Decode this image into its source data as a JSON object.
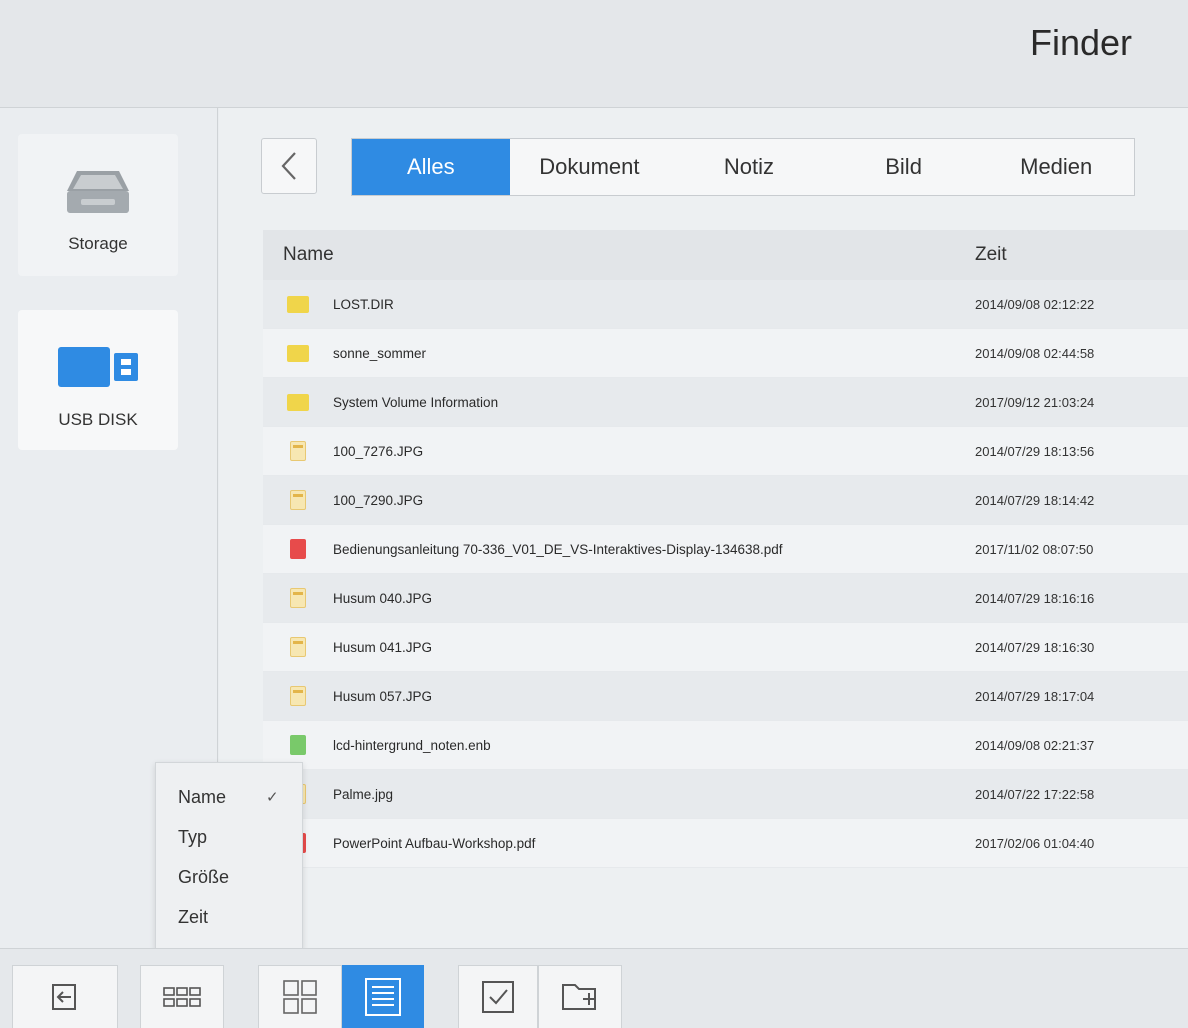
{
  "header": {
    "title": "Finder"
  },
  "sidebar": {
    "items": [
      {
        "label": "Storage",
        "icon": "drive-icon"
      },
      {
        "label": "USB DISK",
        "icon": "usb-icon"
      }
    ]
  },
  "tabs": [
    "Alles",
    "Dokument",
    "Notiz",
    "Bild",
    "Medien"
  ],
  "active_tab": "Alles",
  "table": {
    "headers": {
      "name": "Name",
      "time": "Zeit"
    },
    "rows": [
      {
        "name": "LOST.DIR",
        "time": "2014/09/08 02:12:22",
        "type": "folder"
      },
      {
        "name": "sonne_sommer",
        "time": "2014/09/08 02:44:58",
        "type": "folder"
      },
      {
        "name": "System Volume Information",
        "time": "2017/09/12 21:03:24",
        "type": "folder"
      },
      {
        "name": "100_7276.JPG",
        "time": "2014/07/29 18:13:56",
        "type": "image"
      },
      {
        "name": "100_7290.JPG",
        "time": "2014/07/29 18:14:42",
        "type": "image"
      },
      {
        "name": "Bedienungsanleitung 70-336_V01_DE_VS-Interaktives-Display-134638.pdf",
        "time": "2017/11/02 08:07:50",
        "type": "pdf"
      },
      {
        "name": "Husum 040.JPG",
        "time": "2014/07/29 18:16:16",
        "type": "image"
      },
      {
        "name": "Husum 041.JPG",
        "time": "2014/07/29 18:16:30",
        "type": "image"
      },
      {
        "name": "Husum 057.JPG",
        "time": "2014/07/29 18:17:04",
        "type": "image"
      },
      {
        "name": "lcd-hintergrund_noten.enb",
        "time": "2014/09/08 02:21:37",
        "type": "enb"
      },
      {
        "name": "Palme.jpg",
        "time": "2014/07/22 17:22:58",
        "type": "image"
      },
      {
        "name": "PowerPoint Aufbau-Workshop.pdf",
        "time": "2017/02/06 01:04:40",
        "type": "pdf"
      }
    ]
  },
  "sort_menu": {
    "items": [
      "Name",
      "Typ",
      "Größe",
      "Zeit"
    ],
    "selected": "Name",
    "check": "✓"
  },
  "colors": {
    "accent": "#2f8be3",
    "folder": "#f0d54a",
    "pdf": "#e74b4b",
    "enb": "#79c96a"
  }
}
